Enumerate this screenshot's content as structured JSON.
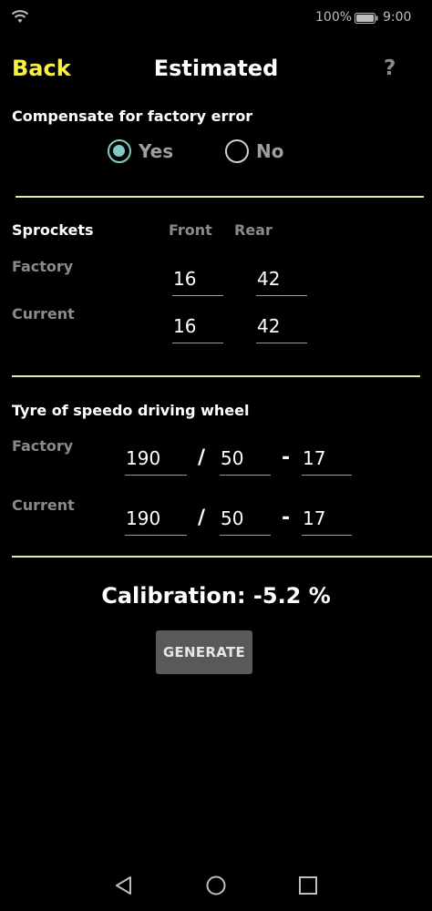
{
  "status_bar": {
    "battery_percent": "100%",
    "time": "9:00",
    "icons": [
      "wifi-icon",
      "battery-icon"
    ]
  },
  "header": {
    "back_label": "Back",
    "title": "Estimated",
    "help_label": "?"
  },
  "compensate": {
    "label": "Compensate for factory error",
    "options": [
      {
        "label": "Yes",
        "selected": true
      },
      {
        "label": "No",
        "selected": false
      }
    ]
  },
  "sprockets": {
    "title": "Sprockets",
    "columns": [
      "Front",
      "Rear"
    ],
    "rows": [
      {
        "label": "Factory",
        "front": "16",
        "rear": "42"
      },
      {
        "label": "Current",
        "front": "16",
        "rear": "42"
      }
    ]
  },
  "tyre": {
    "title": "Tyre of speedo driving wheel",
    "separators": [
      "/",
      "-"
    ],
    "rows": [
      {
        "label": "Factory",
        "width": "190",
        "profile": "50",
        "rim": "17"
      },
      {
        "label": "Current",
        "width": "190",
        "profile": "50",
        "rim": "17"
      }
    ]
  },
  "calibration": {
    "text": "Calibration: -5.2 %"
  },
  "generate_label": "GENERATE",
  "nav_bar": {
    "icons": [
      "back-triangle-icon",
      "home-circle-icon",
      "recents-square-icon"
    ]
  },
  "colors": {
    "accent_yellow": "#f7f046",
    "radio_teal": "#80cbc4",
    "divider": "#e9eaa0",
    "button_bg": "#595959"
  }
}
